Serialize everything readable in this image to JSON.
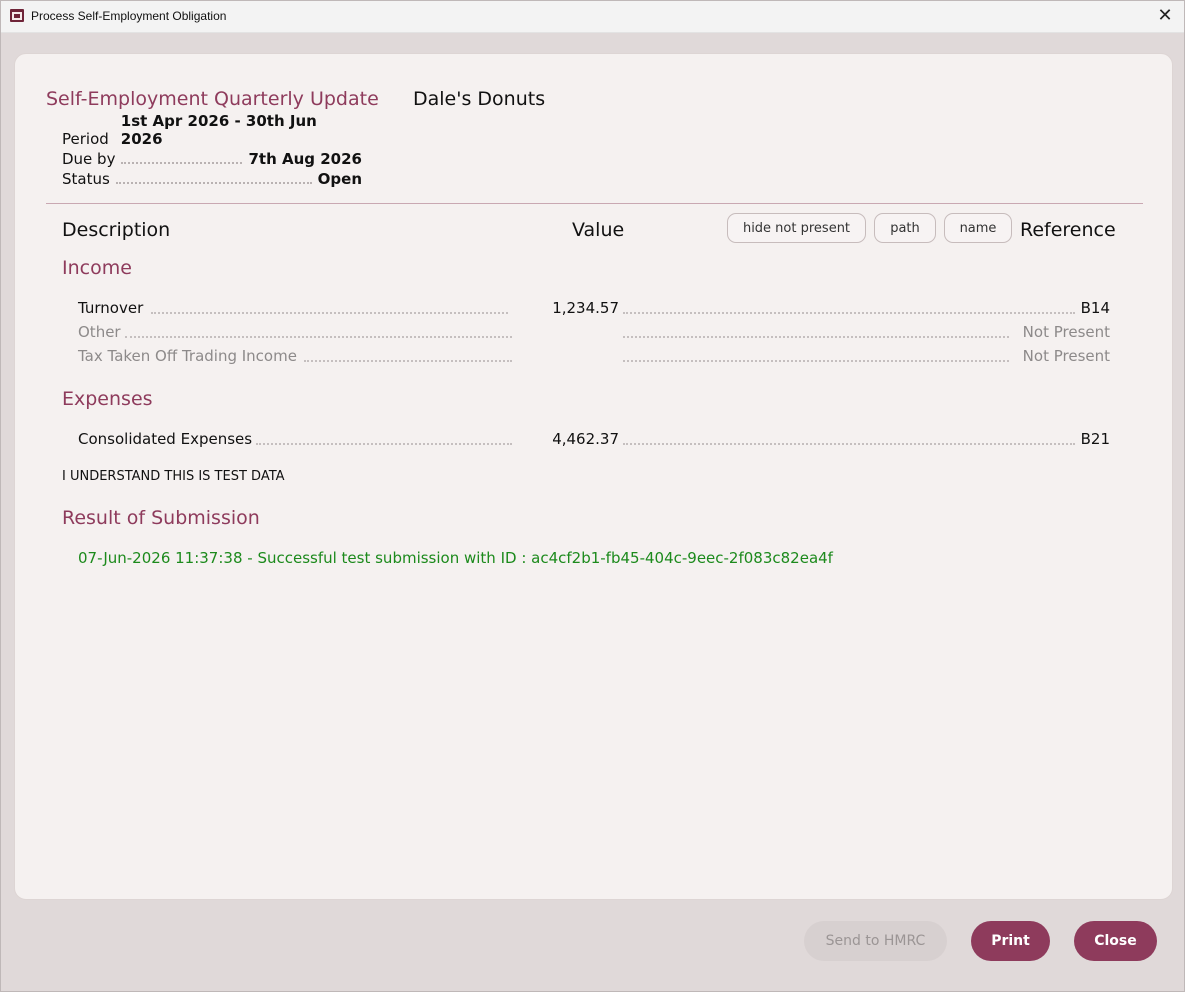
{
  "window": {
    "title": "Process Self-Employment Obligation",
    "close_glyph": "✕"
  },
  "header": {
    "title": "Self-Employment Quarterly Update",
    "business": "Dale's Donuts"
  },
  "meta": [
    {
      "label": "Period",
      "value": "1st Apr 2026 - 30th Jun 2026"
    },
    {
      "label": "Due by",
      "value": "7th Aug 2026"
    },
    {
      "label": "Status",
      "value": "Open"
    }
  ],
  "columns": {
    "description": "Description",
    "value": "Value",
    "reference": "Reference"
  },
  "toggles": {
    "hide": "hide not present",
    "path": "path",
    "name": "name"
  },
  "sections": {
    "income": {
      "title": "Income",
      "rows": [
        {
          "description": "Turnover",
          "value": "1,234.57",
          "reference": "B14"
        },
        {
          "description": "Other",
          "value": "",
          "reference": "Not Present"
        },
        {
          "description": "Tax Taken Off Trading Income",
          "value": "",
          "reference": "Not Present"
        }
      ]
    },
    "expenses": {
      "title": "Expenses",
      "rows": [
        {
          "description": "Consolidated Expenses",
          "value": "4,462.37",
          "reference": "B21"
        }
      ]
    }
  },
  "notice": "I UNDERSTAND THIS IS TEST DATA",
  "result": {
    "title": "Result of Submission",
    "message": "07-Jun-2026 11:37:38 - Successful test submission with ID : ac4cf2b1-fb45-404c-9eec-2f083c82ea4f"
  },
  "footer": {
    "send": "Send to HMRC",
    "print": "Print",
    "close": "Close"
  },
  "colors": {
    "accent": "#8e3b5c",
    "success": "#1c8a1c",
    "muted": "#8d8a8a"
  }
}
